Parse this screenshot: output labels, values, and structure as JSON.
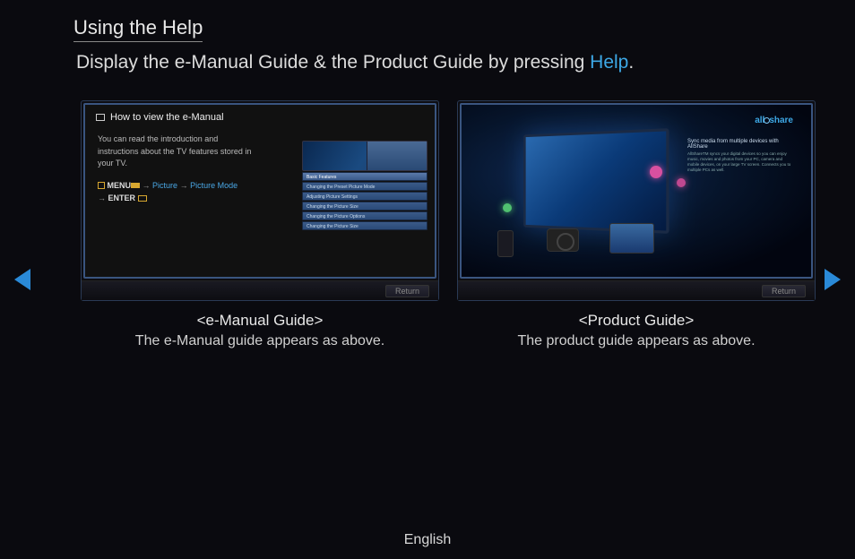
{
  "title": "Using the Help",
  "subtitle_prefix": "Display the e-Manual Guide & the Product Guide by pressing ",
  "subtitle_help": "Help",
  "subtitle_suffix": ".",
  "left_panel": {
    "header": "How to view the e-Manual",
    "body": "You can read the introduction and instructions about the TV features stored in your TV.",
    "menu_label": "MENU",
    "picture": "Picture",
    "picture_mode": "Picture Mode",
    "enter_label": "ENTER",
    "arrow": "→",
    "return_label": "Return",
    "side_header": "Basic Features",
    "side_rows": [
      "Changing the Preset Picture Mode",
      "Adjusting Picture Settings",
      "Changing the Picture Size",
      "Changing the Picture Options",
      "Changing the Picture Size"
    ]
  },
  "right_panel": {
    "logo_text_pre": "all",
    "logo_text_post": "share",
    "headline": "Sync media from multiple devices with AllShare",
    "desc": "AllShareTM syncs your digital devices so you can enjoy music, movies and photos from your PC, camera and mobile devices, on your large TV screen. Connects you to multiple PCs as well.",
    "return_label": "Return"
  },
  "captions": {
    "left_title": "<e-Manual Guide>",
    "left_sub": "The e-Manual guide appears as above.",
    "right_title": "<Product Guide>",
    "right_sub": "The product guide appears as above."
  },
  "language": "English"
}
